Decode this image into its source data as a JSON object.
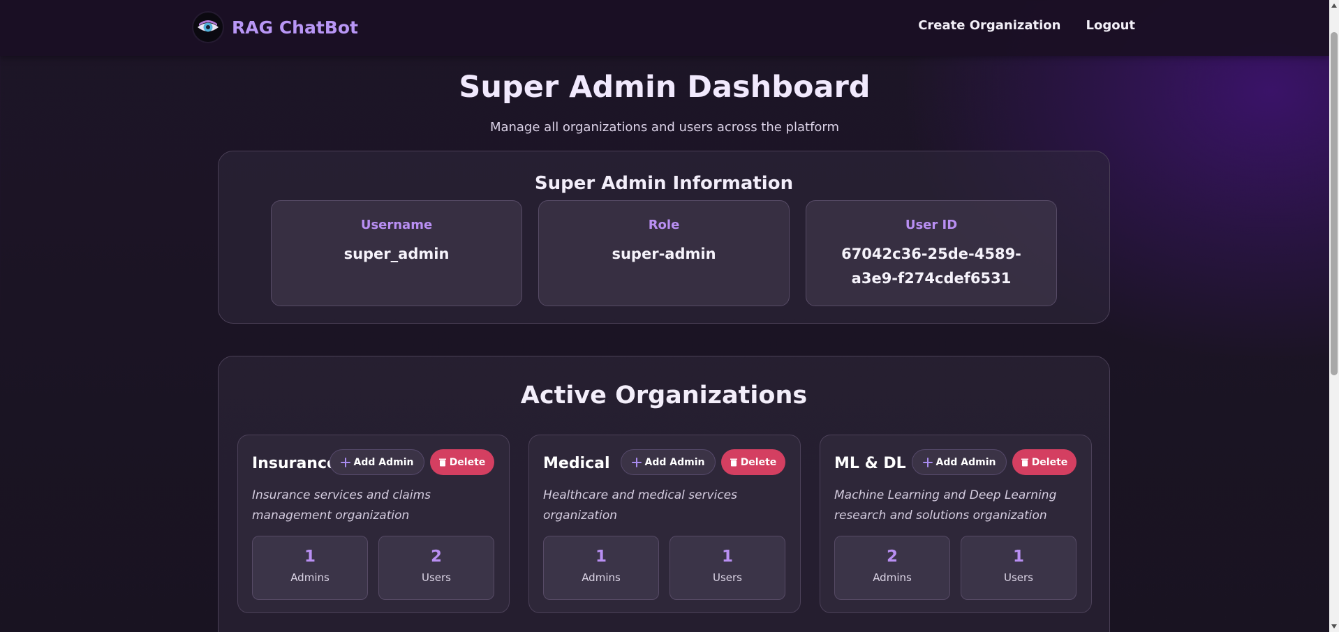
{
  "navbar": {
    "brand_name": "RAG ChatBot",
    "links": [
      "Create Organization",
      "Logout"
    ]
  },
  "header": {
    "title": "Super Admin Dashboard",
    "subtitle": "Manage all organizations and users across the platform"
  },
  "admin_info": {
    "title": "Super Admin Information",
    "fields": [
      {
        "label": "Username",
        "value": "super_admin"
      },
      {
        "label": "Role",
        "value": "super-admin"
      },
      {
        "label": "User ID",
        "value": "67042c36-25de-4589-a3e9-f274cdef6531"
      }
    ]
  },
  "organizations": {
    "title": "Active Organizations",
    "add_admin_label": "Add Admin",
    "delete_label": "Delete",
    "admins_label": "Admins",
    "users_label": "Users",
    "items": [
      {
        "name": "Insurance",
        "description": "Insurance services and claims management organization",
        "admins": "1",
        "users": "2"
      },
      {
        "name": "Medical",
        "description": "Healthcare and medical services organization",
        "admins": "1",
        "users": "1"
      },
      {
        "name": "ML & DL",
        "description": "Machine Learning and Deep Learning research and solutions organization",
        "admins": "2",
        "users": "1"
      }
    ]
  },
  "colors": {
    "accent": "#b98ff3",
    "brand": "#b896f5",
    "danger": "#d43f61"
  }
}
